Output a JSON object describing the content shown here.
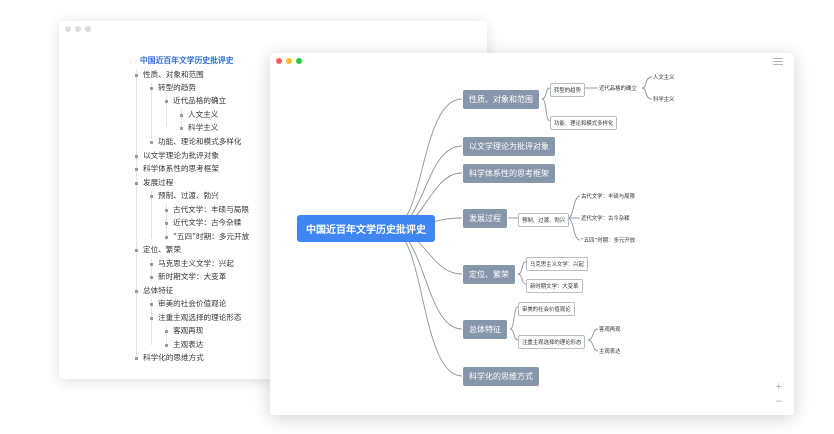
{
  "outline_window": {
    "root_title": "中国近百年文学历史批评史",
    "items": [
      {
        "text": "性质、对象和范围",
        "level": 1
      },
      {
        "text": "转型的趋势",
        "level": 2
      },
      {
        "text": "近代品格的确立",
        "level": 3
      },
      {
        "text": "人文主义",
        "level": 4
      },
      {
        "text": "科学主义",
        "level": 4
      },
      {
        "text": "功能、理论和模式多样化",
        "level": 2
      },
      {
        "text": "以文学理论为批评对象",
        "level": 1
      },
      {
        "text": "科学体系性的思考框架",
        "level": 1
      },
      {
        "text": "发展过程",
        "level": 1
      },
      {
        "text": "预制、过渡、勃兴",
        "level": 2
      },
      {
        "text": "古代文学：丰硕与局限",
        "level": 3
      },
      {
        "text": "近代文学：古今杂糅",
        "level": 3
      },
      {
        "text": "“五四”时期：多元开放",
        "level": 3
      },
      {
        "text": "定位、繁荣",
        "level": 1
      },
      {
        "text": "马克思主义文学：兴起",
        "level": 2
      },
      {
        "text": "新时期文学：大变革",
        "level": 2
      },
      {
        "text": "总体特征",
        "level": 1
      },
      {
        "text": "审美的社会价值观论",
        "level": 2
      },
      {
        "text": "注重主观选择的理论形态",
        "level": 2
      },
      {
        "text": "客观再现",
        "level": 3
      },
      {
        "text": "主观表达",
        "level": 3
      },
      {
        "text": "科学化的思维方式",
        "level": 1
      }
    ]
  },
  "mindmap_window": {
    "root": "中国近百年文学历史批评史",
    "branches": [
      {
        "label": "性质、对象和范围"
      },
      {
        "label": "以文学理论为批评对象"
      },
      {
        "label": "科学体系性的思考框架"
      },
      {
        "label": "发展过程"
      },
      {
        "label": "定位、繁荣"
      },
      {
        "label": "总体特征"
      },
      {
        "label": "科学化的思维方式"
      }
    ],
    "sub_nodes": [
      {
        "label": "转型的趋势"
      },
      {
        "label": "功能、理论和模式多样化"
      },
      {
        "label": "预制、过渡、勃兴"
      },
      {
        "label": "马克思主义文学：兴起"
      },
      {
        "label": "新时期文学：大变革"
      },
      {
        "label": "审美的社会价值观论"
      },
      {
        "label": "注重主观选择的理论形态"
      }
    ],
    "leaf_nodes": [
      {
        "label": "近代品格的确立"
      },
      {
        "label": "人文主义"
      },
      {
        "label": "科学主义"
      },
      {
        "label": "古代文学：丰硕与局限"
      },
      {
        "label": "近代文学：古今杂糅"
      },
      {
        "label": "“五四”时期：多元开放"
      },
      {
        "label": "客观再现"
      },
      {
        "label": "主观表达"
      }
    ],
    "zoom_in": "+",
    "zoom_out": "−"
  },
  "colors": {
    "traffic_close": "#fc5f57",
    "traffic_min": "#fdbc2e",
    "traffic_max": "#28c840",
    "traffic_inactive": "#dcdcdc",
    "root_node": "#3f86f3",
    "main_node": "#8796aa",
    "edge": "#8c949f",
    "outline_root_text": "#2f6fd6"
  }
}
